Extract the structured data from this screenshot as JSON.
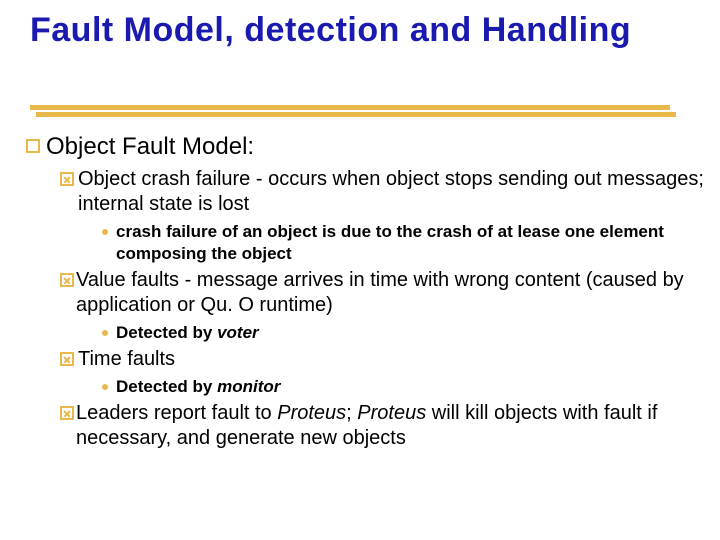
{
  "title": "Fault Model, detection and Handling",
  "lvl1": {
    "text": "Object Fault Model:"
  },
  "p1": {
    "text": "Object crash failure - occurs when object stops sending out messages; internal state is lost",
    "sub": "crash failure of an object is due to the crash of at lease one element composing the object"
  },
  "p2": {
    "text": "Value faults - message arrives in time with wrong content (caused by application or Qu. O runtime)",
    "sub_pre": "Detected by ",
    "sub_it": "voter"
  },
  "p3": {
    "text": "Time faults",
    "sub_pre": "Detected by ",
    "sub_it": "monitor"
  },
  "p4": {
    "a": "Leaders report fault to ",
    "b": "Proteus",
    "c": "; ",
    "d": "Proteus ",
    "e": "will kill objects with fault if necessary, and generate new objects"
  }
}
